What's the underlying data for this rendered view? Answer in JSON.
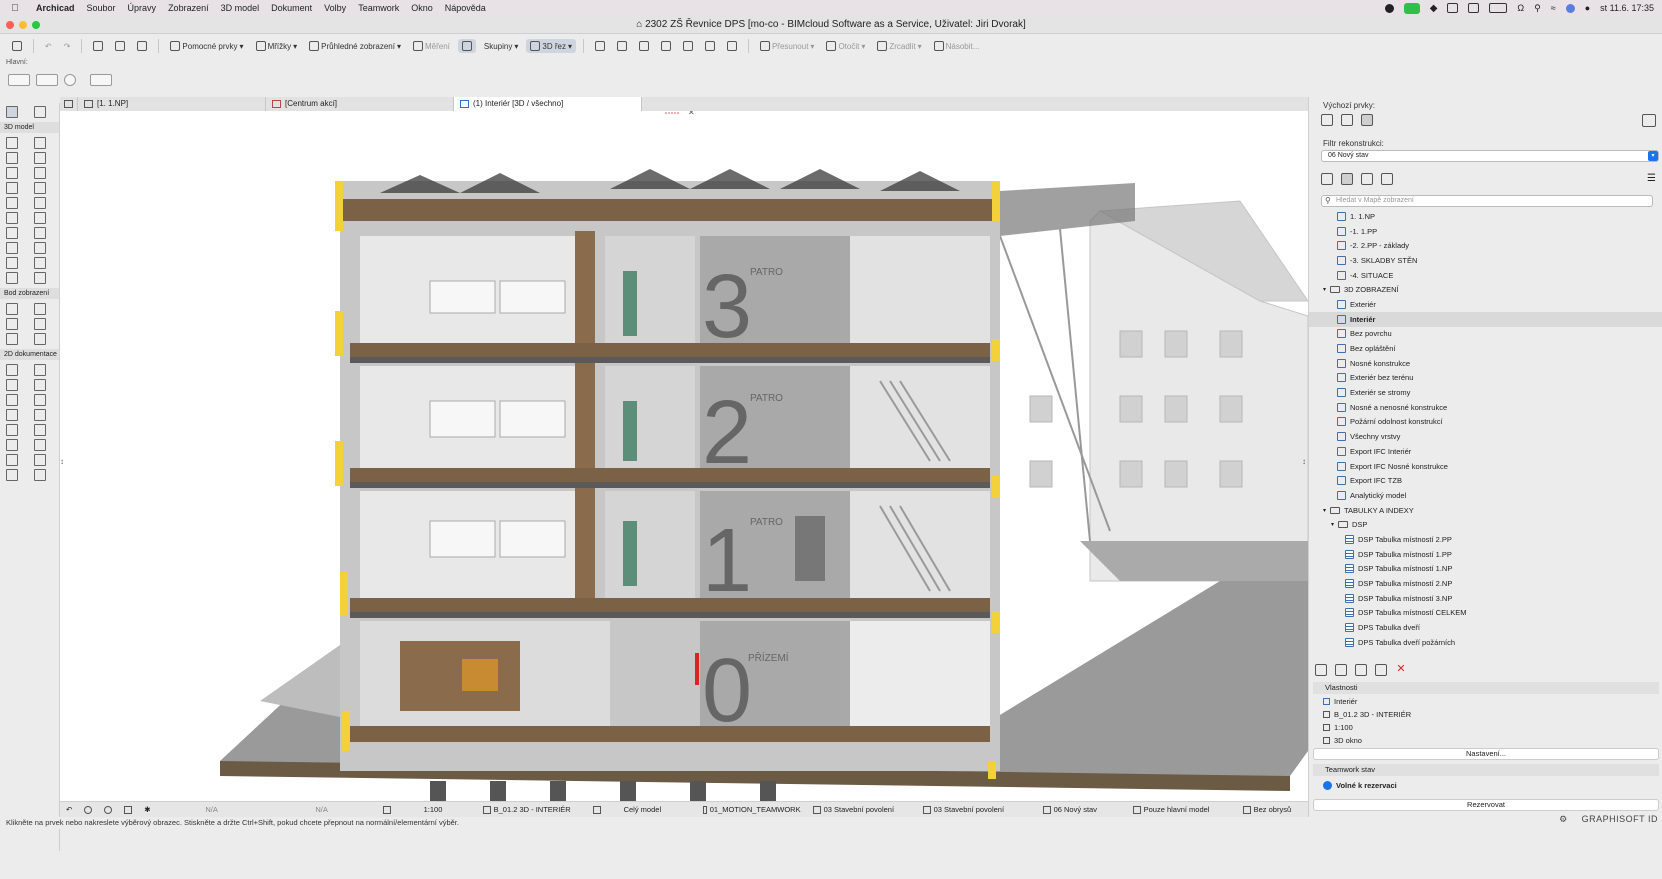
{
  "menubar": {
    "app": "Archicad",
    "items": [
      "Soubor",
      "Úpravy",
      "Zobrazení",
      "3D model",
      "Dokument",
      "Volby",
      "Teamwork",
      "Okno",
      "Nápověda"
    ],
    "clock": "st 11.6.  17:35"
  },
  "window": {
    "title": "2302 ZŠ Řevnice DPS [mo-co - BIMcloud Software as a Service, Uživatel: Jiri Dvorak]"
  },
  "toolbar": {
    "pomocne": "Pomocné prvky",
    "mrizky": "Mřížky",
    "pruhledne": "Průhledné zobrazení",
    "mereni": "Měření",
    "skupiny": "Skupiny",
    "rez3d": "3D řez",
    "presunout": "Přesunout",
    "otocit": "Otočit",
    "zrcadlit": "Zrcadlit",
    "nasobit": "Násobit..."
  },
  "infobox": {
    "label": "Hlavní:"
  },
  "palette": {
    "sec_3d": "3D model",
    "sec_bod": "Bod zobrazení",
    "sec_2d": "2D dokumentace"
  },
  "tabs": [
    "[1. 1.NP]",
    "[Centrum akcí]",
    "(1) Interiér [3D / všechno]"
  ],
  "scene": {
    "floor3": "3",
    "floor2": "2",
    "floor1": "1",
    "floor0": "0",
    "patro": "PATRO",
    "prizemi": "PŘÍZEMÍ"
  },
  "navigator": {
    "default_elements": "Výchozí prvky:",
    "filter_label": "Filtr rekonstrukci:",
    "filter_value": "06 Nový stav",
    "search_placeholder": "Hledat v Mapě zobrazení",
    "tree": [
      {
        "label": "1. 1.NP",
        "indent": 28,
        "kind": "view",
        "sel": false
      },
      {
        "label": "-1. 1.PP",
        "indent": 28,
        "kind": "view",
        "sel": false
      },
      {
        "label": "-2. 2.PP - základy",
        "indent": 28,
        "kind": "view",
        "sel": false
      },
      {
        "label": "-3. SKLADBY STĚN",
        "indent": 28,
        "kind": "view",
        "sel": false
      },
      {
        "label": "-4. SITUACE",
        "indent": 28,
        "kind": "view",
        "sel": false
      },
      {
        "label": "3D ZOBRAZENÍ",
        "indent": 14,
        "kind": "folder",
        "sel": false
      },
      {
        "label": "Exteriér",
        "indent": 28,
        "kind": "view",
        "sel": false
      },
      {
        "label": "Interiér",
        "indent": 28,
        "kind": "view",
        "sel": true
      },
      {
        "label": "Bez povrchu",
        "indent": 28,
        "kind": "view",
        "sel": false
      },
      {
        "label": "Bez opláštění",
        "indent": 28,
        "kind": "view",
        "sel": false
      },
      {
        "label": "Nosné konstrukce",
        "indent": 28,
        "kind": "view",
        "sel": false
      },
      {
        "label": "Exteriér bez terénu",
        "indent": 28,
        "kind": "view",
        "sel": false
      },
      {
        "label": "Exteriér se stromy",
        "indent": 28,
        "kind": "view",
        "sel": false
      },
      {
        "label": "Nosné a nenosné konstrukce",
        "indent": 28,
        "kind": "view",
        "sel": false
      },
      {
        "label": "Požární odolnost konstrukcí",
        "indent": 28,
        "kind": "view",
        "sel": false
      },
      {
        "label": "Všechny vrstvy",
        "indent": 28,
        "kind": "view",
        "sel": false
      },
      {
        "label": "Export IFC Interiér",
        "indent": 28,
        "kind": "view",
        "sel": false
      },
      {
        "label": "Export IFC Nosné konstrukce",
        "indent": 28,
        "kind": "view",
        "sel": false
      },
      {
        "label": "Export IFC TZB",
        "indent": 28,
        "kind": "view",
        "sel": false
      },
      {
        "label": "Analytický model",
        "indent": 28,
        "kind": "view",
        "sel": false
      },
      {
        "label": "TABULKY A INDEXY",
        "indent": 14,
        "kind": "folder",
        "sel": false
      },
      {
        "label": "DSP",
        "indent": 22,
        "kind": "folder",
        "sel": false
      },
      {
        "label": "DSP Tabulka místností 2.PP",
        "indent": 36,
        "kind": "table",
        "sel": false
      },
      {
        "label": "DSP Tabulka místností 1.PP",
        "indent": 36,
        "kind": "table",
        "sel": false
      },
      {
        "label": "DSP Tabulka místností 1.NP",
        "indent": 36,
        "kind": "table",
        "sel": false
      },
      {
        "label": "DSP Tabulka místností 2.NP",
        "indent": 36,
        "kind": "table",
        "sel": false
      },
      {
        "label": "DSP Tabulka místností 3.NP",
        "indent": 36,
        "kind": "table",
        "sel": false
      },
      {
        "label": "DSP Tabulka místností CELKEM",
        "indent": 36,
        "kind": "table",
        "sel": false
      },
      {
        "label": "DPS Tabulka dveří",
        "indent": 36,
        "kind": "table",
        "sel": false
      },
      {
        "label": "DPS Tabulka dveří požárních",
        "indent": 36,
        "kind": "table",
        "sel": false
      }
    ]
  },
  "properties": {
    "header": "Vlastnosti",
    "name": "Interiér",
    "id": "B_01.2 3D - INTERIÉR",
    "scale": "1:100",
    "window": "3D okno",
    "settings_btn": "Nastavení..."
  },
  "teamwork": {
    "header": "Teamwork stav",
    "status": "Volné k rezervaci",
    "reserve_btn": "Rezervovat"
  },
  "statusbar": {
    "na1": "N/A",
    "na2": "N/A",
    "scale": "1:100",
    "view": "B_01.2 3D - INTERIÉR",
    "model": "Celý model",
    "layers": "01_MOTION_TEAMWORK",
    "pen": "03 Stavební povolení",
    "mvo": "03 Stavební povolení",
    "reno": "06 Nový stav",
    "struct": "Pouze hlavní model",
    "dim": "Bez obrysů"
  },
  "hint": "Klikněte na prvek nebo nakreslete výběrový obrazec. Stiskněte a držte Ctrl+Shift, pokud chcete přepnout na normální/elementární výběr.",
  "brand": "GRAPHISOFT ID",
  "colors": {
    "menubar": "#e8e2e6",
    "accent": "#1a73e8",
    "selected": "#d9d9d9"
  }
}
